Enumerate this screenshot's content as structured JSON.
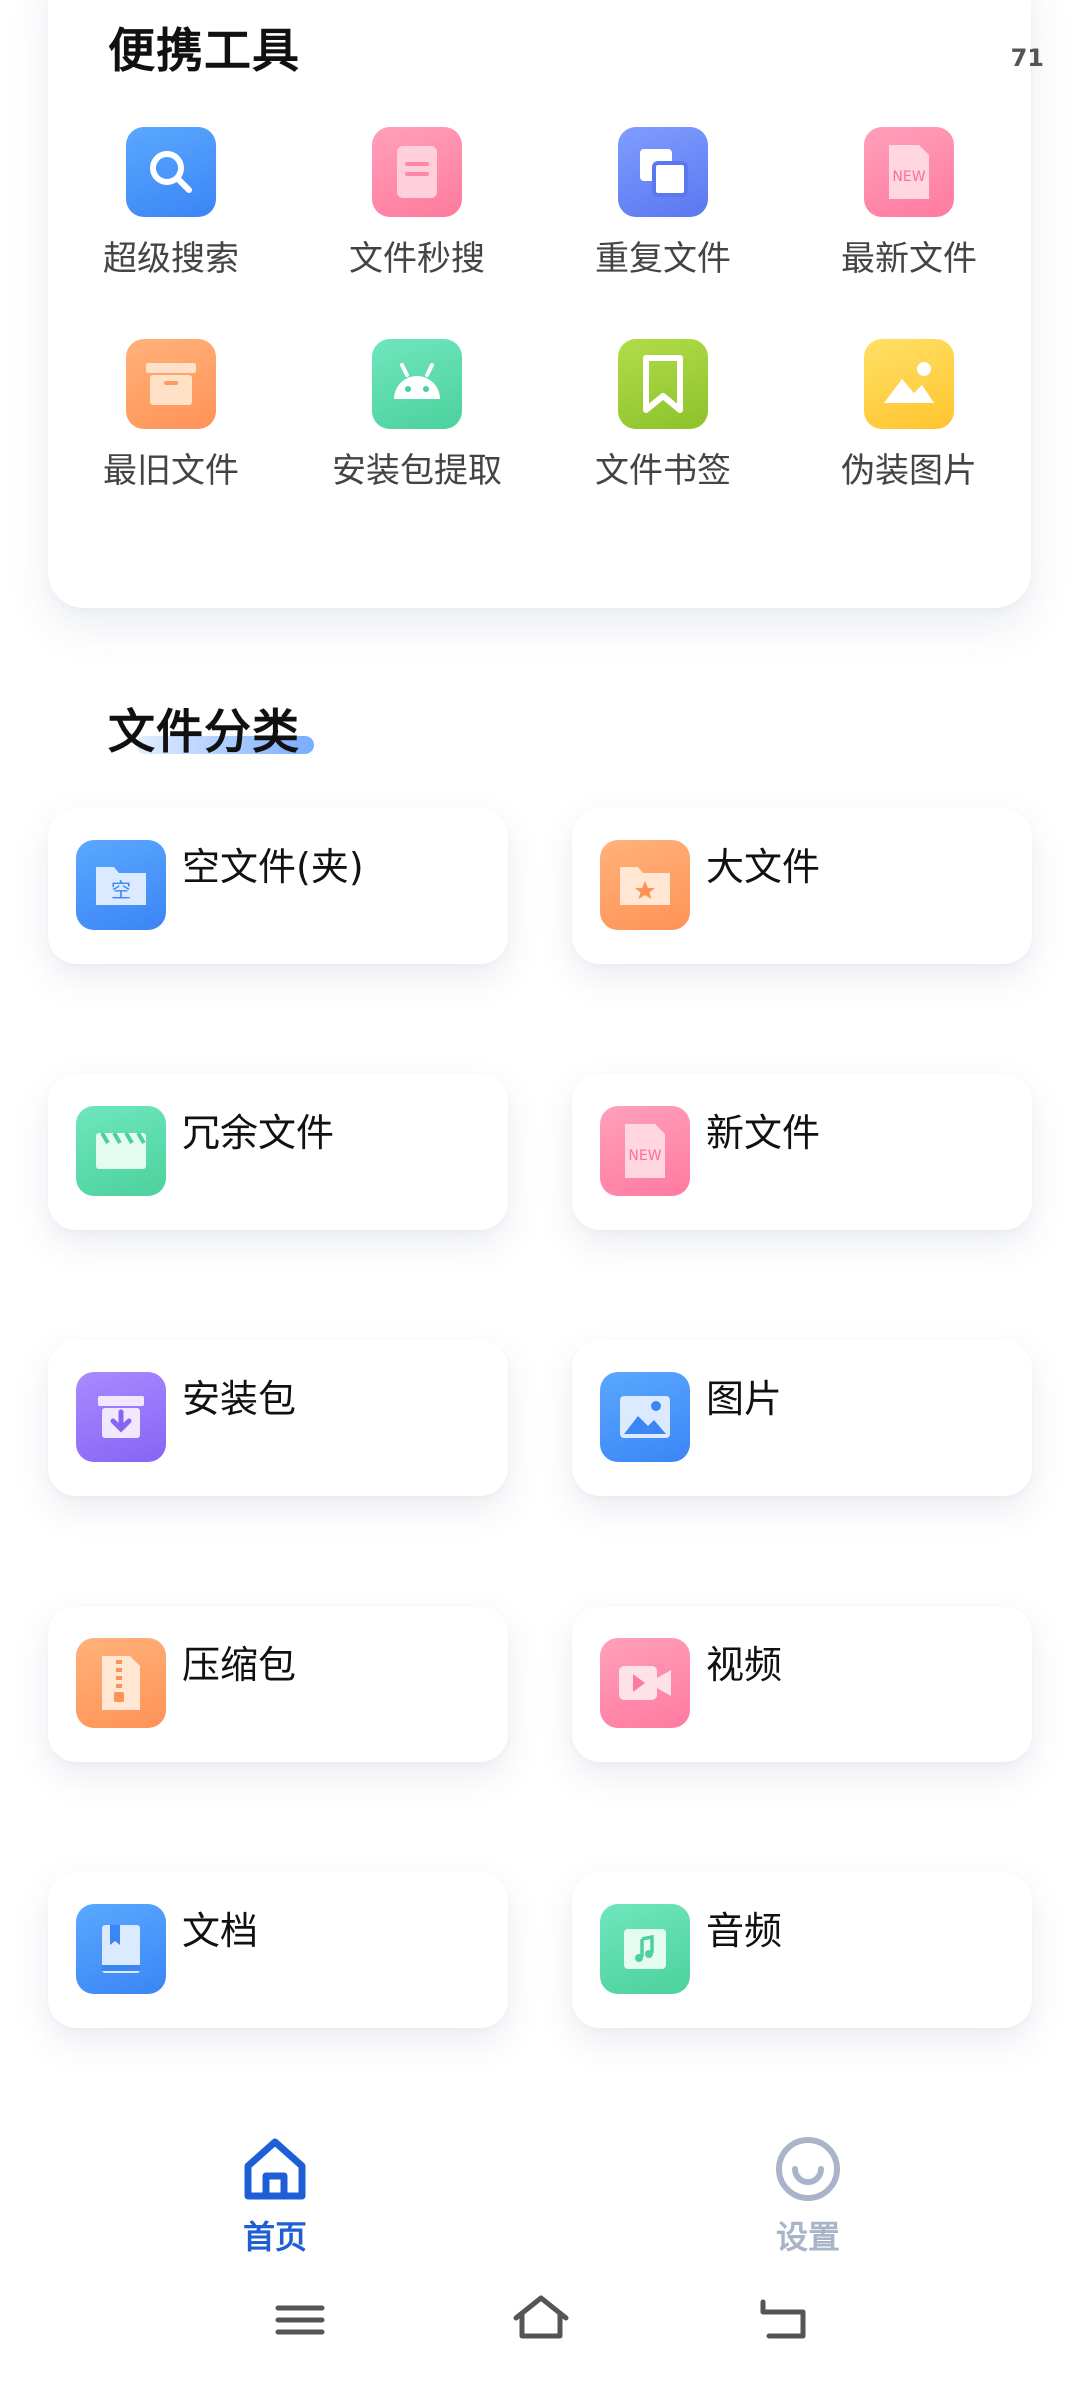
{
  "tools": {
    "title": "便携工具",
    "counter": "71",
    "items": [
      {
        "label": "超级搜索",
        "icon": "search-icon",
        "color": "#4f9bff"
      },
      {
        "label": "文件秒搜",
        "icon": "document-icon",
        "color": "#ff8fab"
      },
      {
        "label": "重复文件",
        "icon": "duplicate-icon",
        "color": "#6e8fff"
      },
      {
        "label": "最新文件",
        "icon": "new-file-icon",
        "color": "#ff8fb0"
      },
      {
        "label": "最旧文件",
        "icon": "archive-box-icon",
        "color": "#ffa36b"
      },
      {
        "label": "安装包提取",
        "icon": "android-icon",
        "color": "#5fdcae"
      },
      {
        "label": "文件书签",
        "icon": "bookmark-icon",
        "color": "#9fcf3a"
      },
      {
        "label": "伪装图片",
        "icon": "image-icon",
        "color": "#ffcf3f"
      }
    ]
  },
  "categories": {
    "title": "文件分类",
    "items": [
      {
        "label": "空文件(夹)",
        "icon": "empty-folder-icon",
        "color": "#4f9bff"
      },
      {
        "label": "大文件",
        "icon": "star-folder-icon",
        "color": "#ffa36b"
      },
      {
        "label": "冗余文件",
        "icon": "clapperboard-icon",
        "color": "#5fdcae"
      },
      {
        "label": "新文件",
        "icon": "new-file-icon",
        "color": "#ff8fb0"
      },
      {
        "label": "安装包",
        "icon": "download-box-icon",
        "color": "#9b7bff"
      },
      {
        "label": "图片",
        "icon": "picture-icon",
        "color": "#4f9bff"
      },
      {
        "label": "压缩包",
        "icon": "zip-icon",
        "color": "#ffa36b"
      },
      {
        "label": "视频",
        "icon": "video-icon",
        "color": "#ff8fb0"
      },
      {
        "label": "文档",
        "icon": "book-icon",
        "color": "#4f9bff"
      },
      {
        "label": "音频",
        "icon": "music-icon",
        "color": "#5fdcae"
      }
    ]
  },
  "bottom_nav": {
    "home": {
      "label": "首页",
      "color": "#1f5fd6"
    },
    "settings": {
      "label": "设置",
      "color": "#aab4c8"
    }
  },
  "system_nav": [
    "menu-icon",
    "home-outline-icon",
    "back-icon"
  ]
}
